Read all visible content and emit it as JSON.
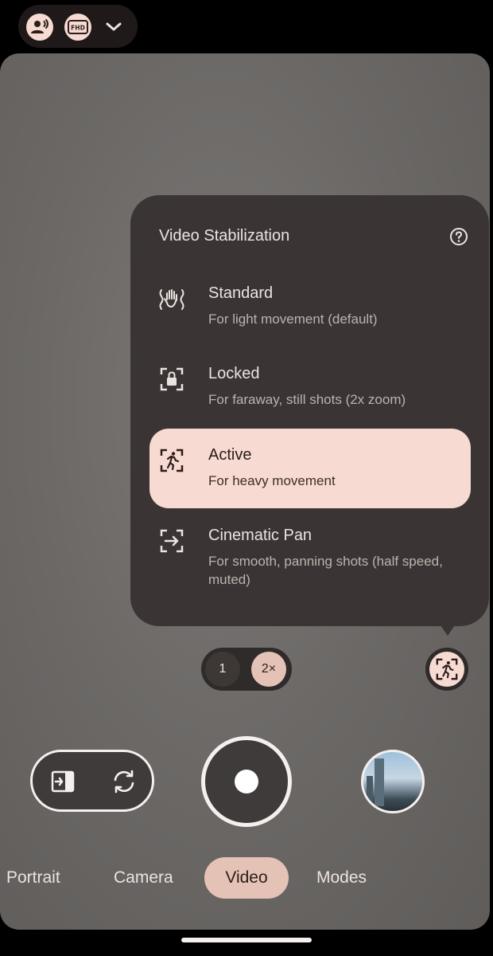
{
  "top_bar": {
    "icons": [
      "audio-user-icon",
      "fhd-resolution-icon",
      "chevron-down-icon"
    ],
    "fhd_label": "FHD"
  },
  "stabilization_panel": {
    "title": "Video Stabilization",
    "help_icon": "help-circle-icon",
    "options": [
      {
        "title": "Standard",
        "subtitle": "For light movement (default)",
        "icon": "hand-shake-icon",
        "selected": false
      },
      {
        "title": "Locked",
        "subtitle": "For faraway, still shots (2x zoom)",
        "icon": "lock-frame-icon",
        "selected": false
      },
      {
        "title": "Active",
        "subtitle": "For heavy movement",
        "icon": "running-frame-icon",
        "selected": true
      },
      {
        "title": "Cinematic Pan",
        "subtitle": "For smooth, panning shots (half speed, muted)",
        "icon": "pan-arrow-icon",
        "selected": false
      }
    ]
  },
  "zoom": {
    "options": [
      "1",
      "2×"
    ],
    "selected": "2×"
  },
  "controls": {
    "switch_icons": [
      "dual-screen-icon",
      "flip-camera-icon"
    ],
    "shutter_icon": "record-icon",
    "thumbnail_icon": "gallery-thumbnail"
  },
  "modes": {
    "items": [
      "Portrait",
      "Camera",
      "Video",
      "Modes"
    ],
    "selected": "Video"
  },
  "colors": {
    "accent": "#f7dbd2",
    "accent_strong": "#e5c2b6",
    "panel": "#3a3534"
  }
}
